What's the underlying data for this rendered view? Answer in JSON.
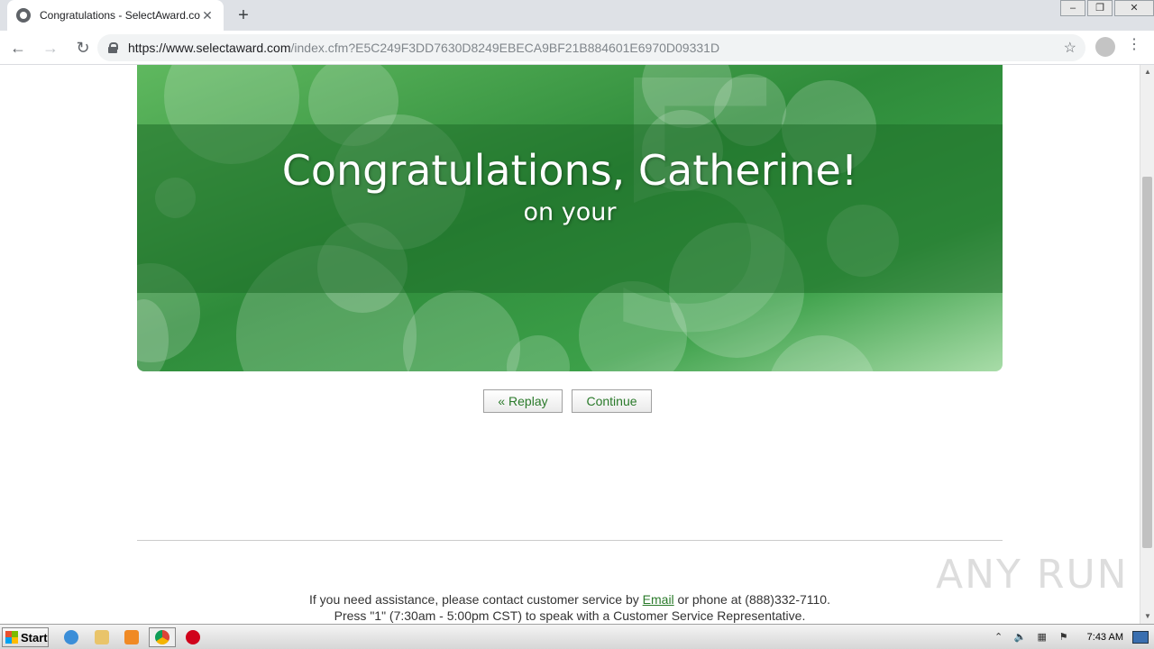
{
  "browser": {
    "tab_title": "Congratulations - SelectAward.com",
    "tab_close": "✕",
    "new_tab": "+",
    "url_host": "https://www.selectaward.com",
    "url_path": "/index.cfm?E5C249F3DD7630D8249EBECA9BF21B884601E6970D09331D",
    "back_icon": "←",
    "forward_icon": "→",
    "reload_icon": "↻",
    "star_icon": "☆",
    "menu_icon": "⋮"
  },
  "banner": {
    "headline": "Congratulations, Catherine!",
    "subline": "on your",
    "background_digit": "5"
  },
  "buttons": {
    "replay": "« Replay",
    "continue": "Continue"
  },
  "footer": {
    "line1_before": "If you need assistance, please contact customer service by ",
    "email_link": "Email",
    "line1_after": " or phone at (888)332-7110.",
    "line2": "Press \"1\" (7:30am - 5:00pm CST) to speak with a Customer Service Representative."
  },
  "watermark": "ANY RUN",
  "taskbar": {
    "start_label": "Start",
    "clock": "7:43 AM"
  },
  "colors": {
    "accent_green": "#2a7a2a",
    "banner_green": "#2e8b3a"
  }
}
